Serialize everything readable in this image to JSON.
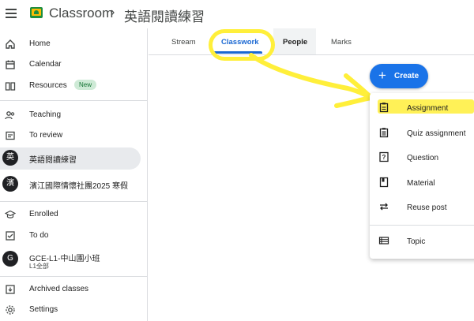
{
  "header": {
    "app_title": "Classroom",
    "separator": "›",
    "class_title": "英語閱讀練習"
  },
  "sidebar": {
    "home": "Home",
    "calendar": "Calendar",
    "resources": "Resources",
    "resources_badge": "New",
    "teaching": "Teaching",
    "to_review": "To review",
    "classes": [
      {
        "avatar": "英",
        "label": "英語閱讀練習"
      },
      {
        "avatar": "濱",
        "label": "濱江國際情懷社團2025 寒假"
      }
    ],
    "enrolled": "Enrolled",
    "to_do": "To do",
    "enrolled_class": {
      "avatar": "G",
      "label": "GCE-L1-中山園小班",
      "sublabel": "L1全部"
    },
    "archived": "Archived classes",
    "settings": "Settings"
  },
  "tabs": [
    "Stream",
    "Classwork",
    "People",
    "Marks"
  ],
  "create_button": {
    "icon": "plus-icon",
    "label": "Create"
  },
  "menu": [
    "Assignment",
    "Quiz assignment",
    "Question",
    "Material",
    "Reuse post",
    "Topic"
  ],
  "colors": {
    "accent": "#1a73e8",
    "highlighter": "#ffef3a",
    "active_tab": "#1967d2"
  }
}
